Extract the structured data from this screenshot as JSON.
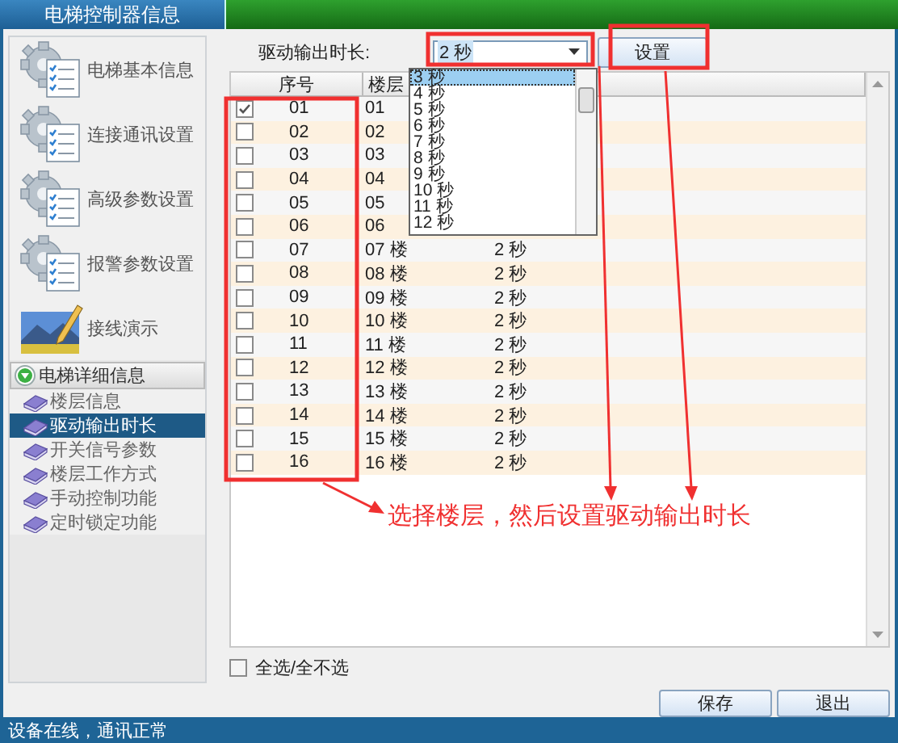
{
  "window": {
    "title": "电梯控制器信息"
  },
  "sidebar": {
    "nav_items": [
      {
        "label": "电梯基本信息",
        "kind": "gear"
      },
      {
        "label": "连接通讯设置",
        "kind": "gear"
      },
      {
        "label": "高级参数设置",
        "kind": "gear"
      },
      {
        "label": "报警参数设置",
        "kind": "gear"
      },
      {
        "label": "接线演示",
        "kind": "picture"
      }
    ],
    "group": {
      "label": "电梯详细信息",
      "expanded": true,
      "items": [
        {
          "label": "楼层信息",
          "selected": false
        },
        {
          "label": "驱动输出时长",
          "selected": true
        },
        {
          "label": "开关信号参数",
          "selected": false
        },
        {
          "label": "楼层工作方式",
          "selected": false
        },
        {
          "label": "手动控制功能",
          "selected": false
        },
        {
          "label": "定时锁定功能",
          "selected": false
        }
      ]
    }
  },
  "duration": {
    "label": "驱动输出时长:",
    "value": "2 秒",
    "set_button": "设置",
    "options": [
      {
        "label": "3 秒",
        "selected": true
      },
      {
        "label": "4 秒",
        "selected": false
      },
      {
        "label": "5 秒",
        "selected": false
      },
      {
        "label": "6 秒",
        "selected": false
      },
      {
        "label": "7 秒",
        "selected": false
      },
      {
        "label": "8 秒",
        "selected": false
      },
      {
        "label": "9 秒",
        "selected": false
      },
      {
        "label": "10 秒",
        "selected": false
      },
      {
        "label": "11 秒",
        "selected": false
      },
      {
        "label": "12 秒",
        "selected": false
      }
    ]
  },
  "table": {
    "columns": [
      "序号",
      "楼层"
    ],
    "rows": [
      {
        "checked": true,
        "index": "01",
        "floor": "01"
      },
      {
        "checked": false,
        "index": "02",
        "floor": "02"
      },
      {
        "checked": false,
        "index": "03",
        "floor": "03"
      },
      {
        "checked": false,
        "index": "04",
        "floor": "04"
      },
      {
        "checked": false,
        "index": "05",
        "floor": "05"
      },
      {
        "checked": false,
        "index": "06",
        "floor": "06"
      },
      {
        "checked": false,
        "index": "07",
        "floor": "07 楼",
        "duration": "2 秒"
      },
      {
        "checked": false,
        "index": "08",
        "floor": "08 楼",
        "duration": "2 秒"
      },
      {
        "checked": false,
        "index": "09",
        "floor": "09 楼",
        "duration": "2 秒"
      },
      {
        "checked": false,
        "index": "10",
        "floor": "10 楼",
        "duration": "2 秒"
      },
      {
        "checked": false,
        "index": "11",
        "floor": "11 楼",
        "duration": "2 秒"
      },
      {
        "checked": false,
        "index": "12",
        "floor": "12 楼",
        "duration": "2 秒"
      },
      {
        "checked": false,
        "index": "13",
        "floor": "13 楼",
        "duration": "2 秒"
      },
      {
        "checked": false,
        "index": "14",
        "floor": "14 楼",
        "duration": "2 秒"
      },
      {
        "checked": false,
        "index": "15",
        "floor": "15 楼",
        "duration": "2 秒"
      },
      {
        "checked": false,
        "index": "16",
        "floor": "16 楼",
        "duration": "2 秒"
      }
    ]
  },
  "select_all": {
    "label": "全选/全不选",
    "checked": false
  },
  "buttons": [
    "保存",
    "退出"
  ],
  "status_bar": "设备在线，通讯正常",
  "annotation": {
    "text": "选择楼层，然后设置驱动输出时长"
  }
}
